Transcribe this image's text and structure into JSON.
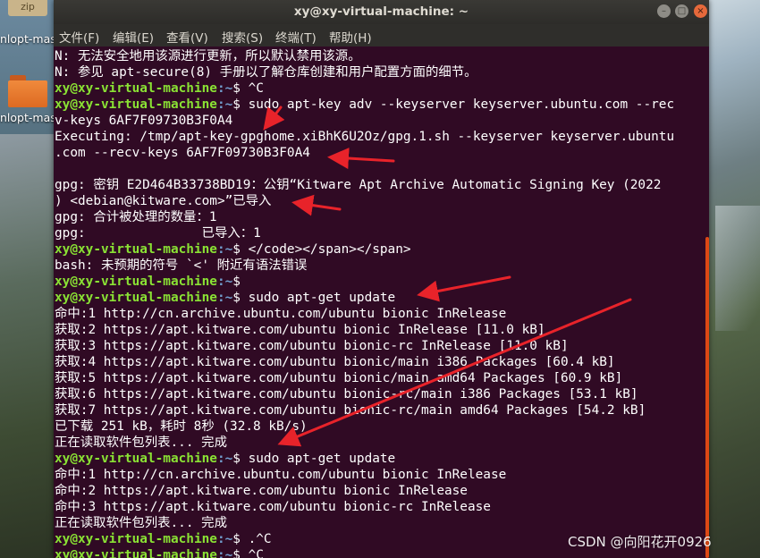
{
  "desktop": {
    "icons": [
      {
        "badge": "zip",
        "label": "nlopt-master.zip"
      },
      {
        "label": "nlopt-master"
      }
    ]
  },
  "window": {
    "title": "xy@xy-virtual-machine: ~",
    "buttons": {
      "minimize": "–",
      "maximize": "□",
      "close": "×"
    }
  },
  "menu": [
    "文件(F)",
    "编辑(E)",
    "查看(V)",
    "搜索(S)",
    "终端(T)",
    "帮助(H)"
  ],
  "terminal": {
    "prompt_user": "xy@xy-virtual-machine",
    "prompt_path": ":~",
    "lines": [
      {
        "kind": "text",
        "text": "N: 无法安全地用该源进行更新，所以默认禁用该源。"
      },
      {
        "kind": "text",
        "text": "N: 参见 apt-secure(8) 手册以了解仓库创建和用户配置方面的细节。"
      },
      {
        "kind": "prompt",
        "cmd": "$ ^C"
      },
      {
        "kind": "prompt",
        "cmd": "$ sudo apt-key adv --keyserver keyserver.ubuntu.com --rec"
      },
      {
        "kind": "text",
        "text": "v-keys 6AF7F09730B3F0A4"
      },
      {
        "kind": "text",
        "text": "Executing: /tmp/apt-key-gpghome.xiBhK6U2Oz/gpg.1.sh --keyserver keyserver.ubuntu"
      },
      {
        "kind": "text",
        "text": ".com --recv-keys 6AF7F09730B3F0A4"
      },
      {
        "kind": "text",
        "text": ""
      },
      {
        "kind": "text",
        "text": "gpg: 密钥 E2D464B33738BD19：公钥“Kitware Apt Archive Automatic Signing Key (2022"
      },
      {
        "kind": "text",
        "text": ") <debian@kitware.com>”已导入"
      },
      {
        "kind": "text",
        "text": "gpg: 合计被处理的数量：1"
      },
      {
        "kind": "text",
        "text": "gpg:               已导入：1"
      },
      {
        "kind": "prompt",
        "cmd": "$ </code></span></span>"
      },
      {
        "kind": "text",
        "text": "bash: 未预期的符号 `<' 附近有语法错误"
      },
      {
        "kind": "prompt",
        "cmd": "$"
      },
      {
        "kind": "prompt",
        "cmd": "$ sudo apt-get update"
      },
      {
        "kind": "text",
        "text": "命中:1 http://cn.archive.ubuntu.com/ubuntu bionic InRelease"
      },
      {
        "kind": "text",
        "text": "获取:2 https://apt.kitware.com/ubuntu bionic InRelease [11.0 kB]"
      },
      {
        "kind": "text",
        "text": "获取:3 https://apt.kitware.com/ubuntu bionic-rc InRelease [11.0 kB]"
      },
      {
        "kind": "text",
        "text": "获取:4 https://apt.kitware.com/ubuntu bionic/main i386 Packages [60.4 kB]"
      },
      {
        "kind": "text",
        "text": "获取:5 https://apt.kitware.com/ubuntu bionic/main amd64 Packages [60.9 kB]"
      },
      {
        "kind": "text",
        "text": "获取:6 https://apt.kitware.com/ubuntu bionic-rc/main i386 Packages [53.1 kB]"
      },
      {
        "kind": "text",
        "text": "获取:7 https://apt.kitware.com/ubuntu bionic-rc/main amd64 Packages [54.2 kB]"
      },
      {
        "kind": "text",
        "text": "已下载 251 kB，耗时 8秒 (32.8 kB/s)"
      },
      {
        "kind": "text",
        "text": "正在读取软件包列表... 完成"
      },
      {
        "kind": "prompt",
        "cmd": "$ sudo apt-get update"
      },
      {
        "kind": "text",
        "text": "命中:1 http://cn.archive.ubuntu.com/ubuntu bionic InRelease"
      },
      {
        "kind": "text",
        "text": "命中:2 https://apt.kitware.com/ubuntu bionic InRelease"
      },
      {
        "kind": "text",
        "text": "命中:3 https://apt.kitware.com/ubuntu bionic-rc InRelease"
      },
      {
        "kind": "text",
        "text": "正在读取软件包列表... 完成"
      },
      {
        "kind": "prompt",
        "cmd": "$ .^C"
      },
      {
        "kind": "prompt",
        "cmd": "$ ^C"
      }
    ]
  },
  "watermark": "CSDN @向阳花开0926",
  "colors": {
    "terminal_bg": "#300a24",
    "prompt_user": "#8ae234",
    "prompt_path": "#729fcf",
    "annotation_arrow": "#e8232a",
    "close_button": "#e6693b"
  }
}
